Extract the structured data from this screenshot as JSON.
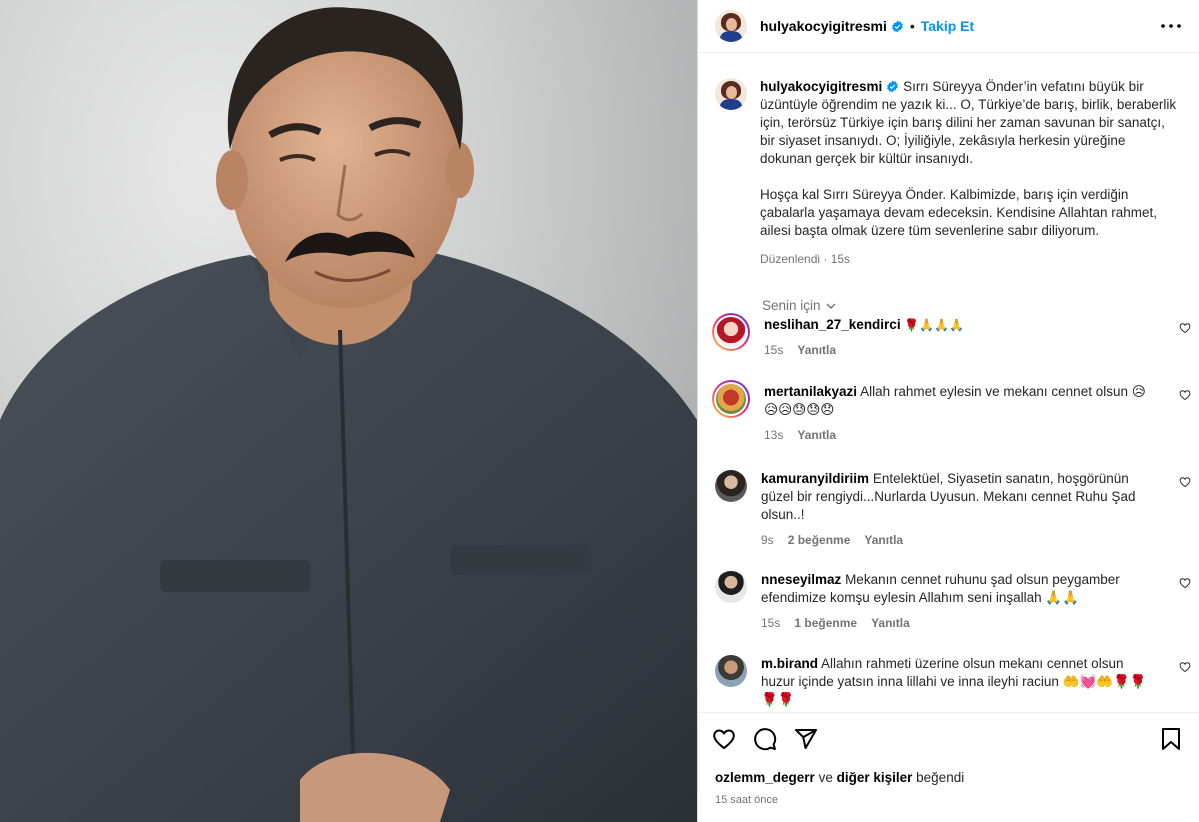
{
  "header": {
    "username": "hulyakocyigitresmi",
    "separator": "•",
    "follow_label": "Takip Et"
  },
  "caption": {
    "username": "hulyakocyigitresmi",
    "paragraph1": "Sırrı Süreyya Önder’in vefatını büyük bir üzüntüyle öğrendim ne yazık ki... O, Türkiye’de barış, birlik, beraberlik için, terörsüz Türkiye için barış dilini her zaman savunan bir sanatçı, bir siyaset insanıydı. O; İyiliğiyle, zekâsıyla herkesin yüreğine dokunan gerçek bir kültür insanıydı.",
    "paragraph2": "Hoşça kal Sırrı Süreyya Önder. Kalbimizde, barış için verdiğin çabalarla yaşamaya devam edeceksin. Kendisine Allahtan rahmet, ailesi başta olmak üzere tüm sevenlerine sabır diliyorum.",
    "edited_label": "Düzenlendi · 15s"
  },
  "sort": {
    "label": "Senin için"
  },
  "comments": [
    {
      "user": "neslihan_27_kendirci",
      "text": "🌹🙏🙏🙏",
      "time": "15s",
      "likes": "",
      "reply": "Yanıtla"
    },
    {
      "user": "mertanilakyazi",
      "text": "Allah rahmet eylesin ve mekanı cennet olsun 😥😥😥😓😓😞",
      "time": "13s",
      "likes": "",
      "reply": "Yanıtla"
    },
    {
      "user": "kamuranyildiriim",
      "text": "Entelektüel, Siyasetin sanatın, hoşgörünün güzel bir rengiydi...Nurlarda Uyusun. Mekanı cennet Ruhu Şad olsun..!",
      "time": "9s",
      "likes": "2 beğenme",
      "reply": "Yanıtla"
    },
    {
      "user": "nneseyilmaz",
      "text": "Mekanın cennet ruhunu şad olsun peygamber efendimize komşu eylesin Allahım seni inşallah 🙏🙏",
      "time": "15s",
      "likes": "1 beğenme",
      "reply": "Yanıtla"
    },
    {
      "user": "m.birand",
      "text": "Allahın rahmeti üzerine olsun mekanı cennet olsun huzur içinde yatsın inna lillahi ve inna ileyhi raciun 🤲💓🤲🌹🌹🌹🌹",
      "time": "",
      "likes": "",
      "reply": ""
    }
  ],
  "likes": {
    "user": "ozlemm_degerr",
    "connector": "ve",
    "others": "diğer kişiler",
    "suffix": "beğendi"
  },
  "timestamp": "15 saat önce",
  "icons": [
    "more-options-icon",
    "verified-badge-icon",
    "chevron-down-icon",
    "heart-icon",
    "comment-icon",
    "share-icon",
    "bookmark-icon"
  ],
  "colors": {
    "accent": "#0095f6",
    "muted": "#737373",
    "border": "#dbdbdb"
  }
}
